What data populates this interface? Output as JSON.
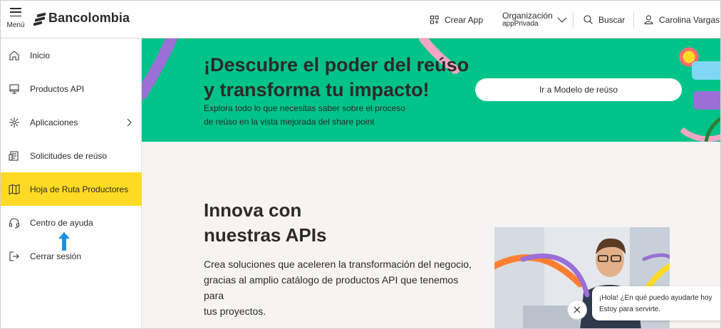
{
  "header": {
    "menu_label": "Menú",
    "brand": "Bancolombia",
    "crear_app": "Crear App",
    "org_label": "Organización",
    "org_value": "appPrivada",
    "search": "Buscar",
    "user_name": "Carolina Vargas Ja"
  },
  "sidebar": {
    "items": [
      {
        "label": "Inicio",
        "icon": "home-icon"
      },
      {
        "label": "Productos API",
        "icon": "monitor-icon"
      },
      {
        "label": "Aplicaciones",
        "icon": "apps-icon"
      },
      {
        "label": "Solicitudes de reúso",
        "icon": "request-icon"
      },
      {
        "label": "Hoja de Ruta Productores",
        "icon": "map-icon"
      },
      {
        "label": "Centro de ayuda",
        "icon": "headset-icon"
      },
      {
        "label": "Cerrar sesión",
        "icon": "logout-icon"
      }
    ],
    "active_index": 4
  },
  "banner": {
    "title_line1": "¡Descubre el poder del reúso",
    "title_line2": "y transforma tu impacto!",
    "desc_line1": "Explora todo lo que necesitas saber sobre el proceso",
    "desc_line2": "de reúso en la vista mejorada del share point",
    "cta": "Ir a Modelo de reúso"
  },
  "innova": {
    "title_line1": "Innova con",
    "title_line2": "nuestras APIs",
    "desc_line1": "Crea soluciones que aceleren la transformación del negocio,",
    "desc_line2": "gracias al amplio catálogo de productos API que tenemos",
    "desc_line3": "para",
    "desc_line4": "tus proyectos."
  },
  "chat": {
    "line1": "¡Hola! ¿En qué puedo ayudarte hoy",
    "line2": "Estoy para servirte."
  },
  "colors": {
    "brand_yellow": "#fdda24",
    "banner_green": "#00c389",
    "text_dark": "#2c2a29",
    "arrow_blue": "#1e8fe1"
  }
}
